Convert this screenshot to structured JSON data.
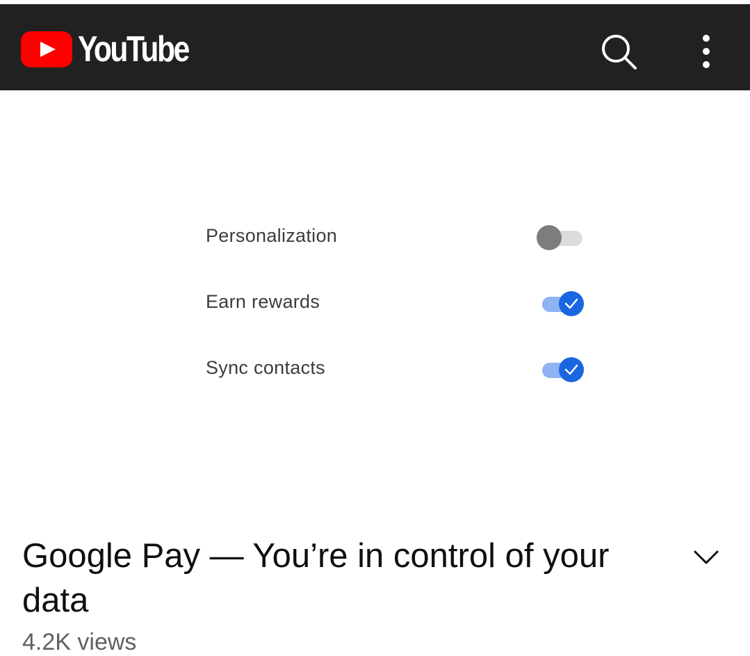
{
  "header": {
    "brand": "YouTube",
    "icons": [
      "youtube-logo",
      "search-icon",
      "more-vert-icon"
    ],
    "colors": {
      "bar": "#212121",
      "brand_red": "#ff0000"
    }
  },
  "video": {
    "settings": [
      {
        "label": "Personalization",
        "enabled": false
      },
      {
        "label": "Earn rewards",
        "enabled": true
      },
      {
        "label": "Sync contacts",
        "enabled": true
      }
    ],
    "toggle_on_color": "#1a66e0"
  },
  "details": {
    "title": "Google Pay — You’re in control of your data",
    "views": "4.2K views"
  }
}
